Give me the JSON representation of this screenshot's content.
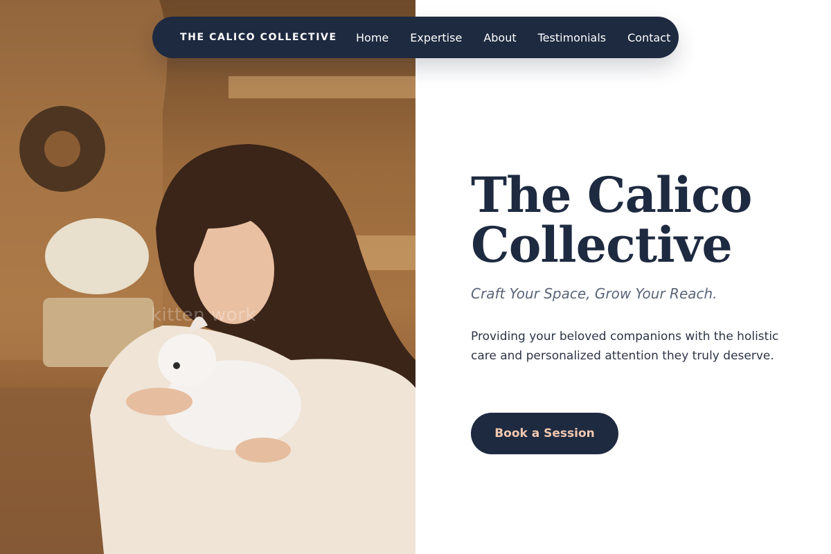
{
  "nav": {
    "brand": "THE CALICO COLLECTIVE",
    "links": [
      "Home",
      "Expertise",
      "About",
      "Testimonials",
      "Contact"
    ]
  },
  "hero": {
    "title_line1": "The Calico",
    "title_line2": "Collective",
    "tagline": "Craft Your Space, Grow Your Reach.",
    "description": "Providing your beloved companions with the holistic care and personalized attention they truly deserve.",
    "cta_label": "Book a Session",
    "image_watermark": "kitten work"
  },
  "colors": {
    "navy": "#1e2a40",
    "cta_text": "#f3c8b0",
    "tagline": "#5a6578",
    "body_text": "#2c3446",
    "background": "#ffffff"
  }
}
